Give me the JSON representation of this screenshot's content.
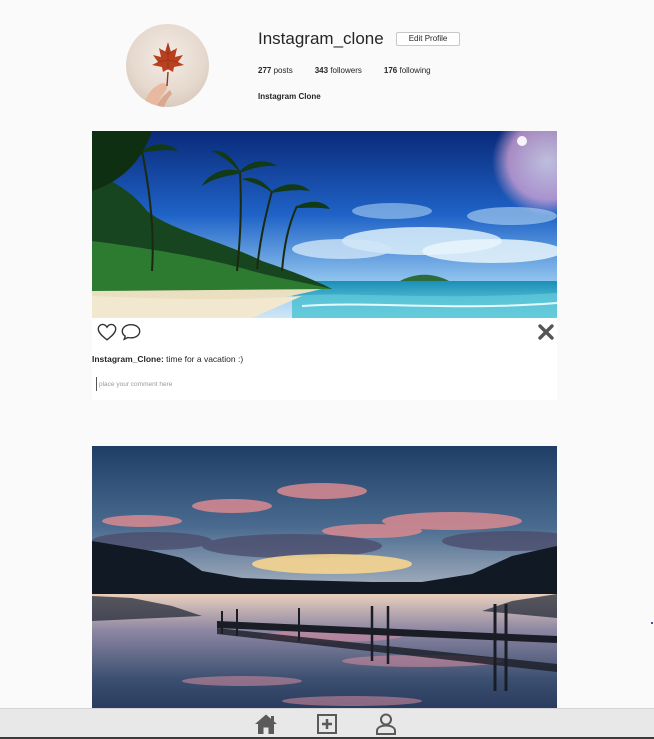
{
  "profile": {
    "username": "Instagram_clone",
    "edit_button": "Edit Profile",
    "stats": {
      "posts_count": "277",
      "posts_label": "posts",
      "followers_count": "343",
      "followers_label": "followers",
      "following_count": "176",
      "following_label": "following"
    },
    "full_name": "Instagram Clone",
    "avatar_icon": "maple-leaf"
  },
  "posts": [
    {
      "image": "tropical-beach-night-sky",
      "caption_user": "Instagram_Clone:",
      "caption_text": " time for a vacation :)",
      "comment_placeholder": "place your comment here"
    },
    {
      "image": "lake-sunset-pier",
      "caption_user": "",
      "caption_text": "",
      "comment_placeholder": ""
    }
  ],
  "icons": {
    "like": "heart-outline",
    "comment": "speech-bubble",
    "delete": "close-x"
  },
  "bottom_nav": [
    {
      "name": "home",
      "icon": "home-icon"
    },
    {
      "name": "add-post",
      "icon": "plus-square-icon"
    },
    {
      "name": "profile",
      "icon": "user-icon"
    }
  ],
  "colors": {
    "background": "#fafafa",
    "text": "#262626",
    "nav_background": "#e8e8e8",
    "icon_gray": "#555555"
  }
}
